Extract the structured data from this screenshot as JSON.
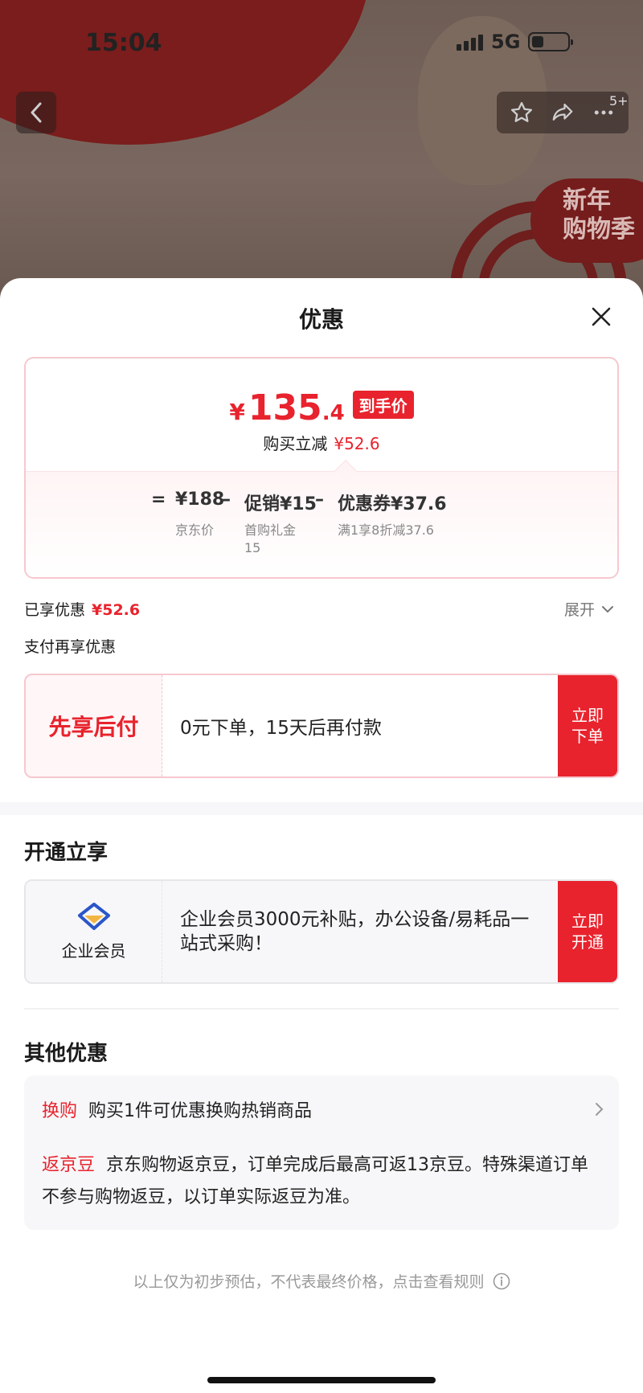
{
  "status_bar": {
    "time": "15:04",
    "network": "5G"
  },
  "background": {
    "promo_badge": "新年\n购物季",
    "msg_count": "5+"
  },
  "sheet": {
    "title": "优惠",
    "price_card": {
      "currency": "¥",
      "price_int": "135",
      "price_dec": ".4",
      "price_tag": "到手价",
      "save_label": "购买立减",
      "save_amount": "¥52.6",
      "formula": {
        "eq": "=",
        "base_value": "¥188",
        "base_label": "京东价",
        "minus1": "–",
        "promo_value": "促销¥15",
        "promo_label": "首购礼金\n15",
        "minus2": "–",
        "coupon_value": "优惠券¥37.6",
        "coupon_label": "满1享8折减37.6"
      }
    },
    "enjoyed": {
      "label": "已享优惠",
      "amount": "¥52.6",
      "expand": "展开"
    },
    "pay_more_label": "支付再享优惠",
    "bnpl": {
      "title": "先享后付",
      "desc": "0元下单，15天后再付款",
      "cta": "立即下单"
    },
    "open_section": {
      "title": "开通立享",
      "member_label": "企业会员",
      "desc": "企业会员3000元补贴，办公设备/易耗品一站式采购！",
      "cta": "立即开通"
    },
    "other_section": {
      "title": "其他优惠",
      "exchange_tag": "换购",
      "exchange_text": "购买1件可优惠换购热销商品",
      "bean_tag": "返京豆",
      "bean_text": "京东购物返京豆，订单完成后最高可返13京豆。特殊渠道订单不参与购物返豆，以订单实际返豆为准。"
    },
    "disclaimer": "以上仅为初步预估，不代表最终价格，点击查看规则"
  },
  "colors": {
    "accent": "#e8232d",
    "pink_border": "#f6c8cf",
    "gray_bg": "#f7f7f9"
  },
  "icons": [
    "back-icon",
    "star-icon",
    "share-icon",
    "more-icon",
    "close-icon",
    "chevron-down-icon",
    "member-diamond-icon",
    "chevron-right-icon",
    "info-icon"
  ]
}
